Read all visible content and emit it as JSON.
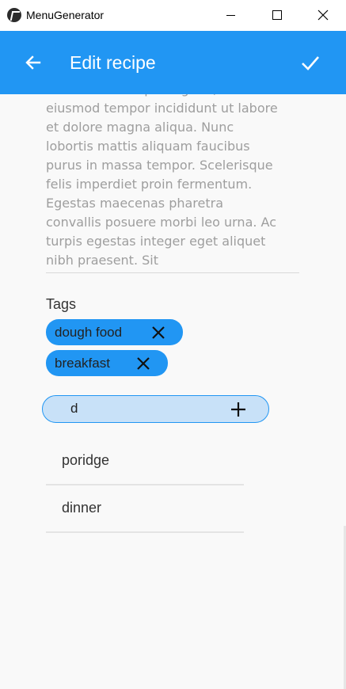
{
  "window": {
    "title": "MenuGenerator"
  },
  "appbar": {
    "title": "Edit recipe",
    "back_icon": "arrow-left-icon",
    "confirm_icon": "check-icon",
    "color": "#2196f3"
  },
  "description": {
    "text": "consectetur adipiscing elit, sed do\neiusmod tempor incididunt ut labore\n et dolore magna aliqua. Nunc\nlobortis mattis aliquam faucibus\npurus in massa tempor. Scelerisque\n felis imperdiet proin fermentum.\nEgestas maecenas pharetra\nconvallis posuere morbi leo urna. Ac\n turpis egestas integer eget aliquet\nnibh praesent. Sit"
  },
  "tags": {
    "label": "Tags",
    "items": [
      {
        "label": "dough food"
      },
      {
        "label": "breakfast"
      }
    ],
    "input_value": "d",
    "add_icon": "plus-icon"
  },
  "suggestions": [
    {
      "label": "poridge"
    },
    {
      "label": "dinner"
    }
  ]
}
